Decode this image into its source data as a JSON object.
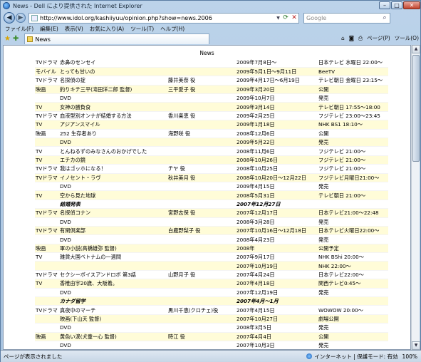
{
  "window": {
    "title": "News - Dell により提供された Internet Explorer"
  },
  "address": {
    "url": "http://www.idol.org/kashiiyuu/opinion.php?show=news.2006",
    "search_placeholder": "Google"
  },
  "menu": [
    "ファイル(F)",
    "編集(E)",
    "表示(V)",
    "お気に入り(A)",
    "ツール(T)",
    "ヘルプ(H)"
  ],
  "tab": {
    "label": "News"
  },
  "commands": {
    "page": "ページ(P)",
    "tools": "ツール(O)"
  },
  "page": {
    "heading": "News",
    "rows": [
      {
        "cat": "TVドラマ",
        "title": "赤鼻のセンセイ",
        "role": "",
        "date": "2009年7月8日～",
        "info": "日本テレビ 水曜日 22:00～",
        "alt": false,
        "section": false
      },
      {
        "cat": "モバイル",
        "title": "とっても甘いの",
        "role": "",
        "date": "2009年5月1日～9月11日",
        "info": "BeeTV",
        "alt": true,
        "section": false
      },
      {
        "cat": "TVドラマ",
        "title": "名探偵の掟",
        "role": "藤井美奈 役",
        "date": "2009年4月17日～6月19日",
        "info": "テレビ朝日 金曜日 23:15～",
        "alt": false,
        "section": false
      },
      {
        "cat": "映画",
        "title": "釣りキチ三平(滝田洋二郎 監督)",
        "role": "三平愛子 役",
        "date": "2009年3月20日",
        "info": "公開",
        "alt": true,
        "section": false
      },
      {
        "cat": "",
        "title": "DVD",
        "role": "",
        "date": "2009年10月7日",
        "info": "発売",
        "alt": false,
        "section": false
      },
      {
        "cat": "TV",
        "title": "女神の勝負食",
        "role": "",
        "date": "2009年3月14日",
        "info": "テレビ朝日 17:55～18:00",
        "alt": true,
        "section": false
      },
      {
        "cat": "TVドラマ",
        "title": "血液型別オンナが結婚する方法",
        "role": "香川楽恵 役",
        "date": "2009年2月25日",
        "info": "フジテレビ 23:00～23:45",
        "alt": false,
        "section": false
      },
      {
        "cat": "TV",
        "title": "アジアンスマイル",
        "role": "",
        "date": "2009年1月18日",
        "info": "NHK BS1 18:10～",
        "alt": true,
        "section": false
      },
      {
        "cat": "映画",
        "title": "252 生存者あり",
        "role": "海野咲 役",
        "date": "2008年12月6日",
        "info": "公開",
        "alt": false,
        "section": false
      },
      {
        "cat": "",
        "title": "DVD",
        "role": "",
        "date": "2009年5月22日",
        "info": "発売",
        "alt": true,
        "section": false
      },
      {
        "cat": "TV",
        "title": "とんねるずのみなさんのおかげでした",
        "role": "",
        "date": "2008年11月6日",
        "info": "フジテレビ 21:00～",
        "alt": false,
        "section": false
      },
      {
        "cat": "TV",
        "title": "エチカの鏡",
        "role": "",
        "date": "2008年10月26日",
        "info": "フジテレビ 21:00～",
        "alt": true,
        "section": false
      },
      {
        "cat": "TVドラマ",
        "title": "我はゴッホになる！",
        "role": "チヤ 役",
        "date": "2008年10月25日",
        "info": "フジテレビ 21:00～",
        "alt": false,
        "section": false
      },
      {
        "cat": "TVドラマ",
        "title": "イノセント・ラヴ",
        "role": "秋井美月 役",
        "date": "2008年10月20日～12月22日",
        "info": "フジテレビ月曜日21:00～",
        "alt": true,
        "section": false
      },
      {
        "cat": "",
        "title": "DVD",
        "role": "",
        "date": "2009年4月15日",
        "info": "発売",
        "alt": false,
        "section": false
      },
      {
        "cat": "TV",
        "title": "空から見た地球",
        "role": "",
        "date": "2008年5月31日",
        "info": "テレビ朝日 21:00～",
        "alt": true,
        "section": false
      },
      {
        "cat": "",
        "title": "結婚発表",
        "role": "",
        "date": "2007年12月27日",
        "info": "",
        "alt": false,
        "section": true
      },
      {
        "cat": "TVドラマ",
        "title": "名探偵コナン",
        "role": "宮野志保 役",
        "date": "2007年12月17日",
        "info": "日本テレビ21:00～22:48",
        "alt": true,
        "section": false
      },
      {
        "cat": "",
        "title": "DVD",
        "role": "",
        "date": "2008年3月28日",
        "info": "発売",
        "alt": false,
        "section": false
      },
      {
        "cat": "TVドラマ",
        "title": "有閑倶楽部",
        "role": "白鹿野梨子 役",
        "date": "2007年10月16日～12月18日",
        "info": "日本テレビ火曜日22:00～",
        "alt": true,
        "section": false
      },
      {
        "cat": "",
        "title": "DVD",
        "role": "",
        "date": "2008年4月23日",
        "info": "発売",
        "alt": false,
        "section": false
      },
      {
        "cat": "映画",
        "title": "軍の小説(高橋雄弥 監督)",
        "role": "",
        "date": "2008年",
        "info": "公開予定",
        "alt": true,
        "section": false
      },
      {
        "cat": "TV",
        "title": "雑貨大国ベトナムの一週間",
        "role": "",
        "date": "2007年9月17日",
        "info": "NHK BShi 20:00～",
        "alt": false,
        "section": false
      },
      {
        "cat": "",
        "title": "",
        "role": "",
        "date": "2007年10月19日",
        "info": "NHK 22:00～",
        "alt": true,
        "section": false
      },
      {
        "cat": "TVドラマ",
        "title": "セクシーボイスアンドロボ 第3話",
        "role": "山野月子 役",
        "date": "2007年4月24日",
        "info": "日本テレビ22:00～",
        "alt": false,
        "section": false
      },
      {
        "cat": "TV",
        "title": "香椎由宇20歳、大阪着。",
        "role": "",
        "date": "2007年4月18日",
        "info": "関西テレビ0:45～",
        "alt": true,
        "section": false
      },
      {
        "cat": "",
        "title": "DVD",
        "role": "",
        "date": "2007年12月19日",
        "info": "発売",
        "alt": false,
        "section": false
      },
      {
        "cat": "",
        "title": "カナダ留学",
        "role": "",
        "date": "2007年4月～1月",
        "info": "",
        "alt": true,
        "section": true
      },
      {
        "cat": "TVドラマ",
        "title": "真夜中のマーチ",
        "role": "黒川千恵(クロチェ)役",
        "date": "2007年4月15日",
        "info": "WOWOW 20:00～",
        "alt": false,
        "section": false
      },
      {
        "cat": "",
        "title": "映画(下山天 監督)",
        "role": "",
        "date": "2007年10月27日",
        "info": "劇場公開",
        "alt": true,
        "section": false
      },
      {
        "cat": "",
        "title": "DVD",
        "role": "",
        "date": "2008年3月5日",
        "info": "発売",
        "alt": false,
        "section": false
      },
      {
        "cat": "映画",
        "title": "黄色い涙(犬童一心 監督)",
        "role": "時江 役",
        "date": "2007年4月4日",
        "info": "公開",
        "alt": true,
        "section": false
      },
      {
        "cat": "",
        "title": "DVD",
        "role": "",
        "date": "2007年10月3日",
        "info": "発売",
        "alt": false,
        "section": false
      },
      {
        "cat": "TV",
        "title": "伝説の白きライオンを求めて",
        "role": "",
        "date": "2007年3月3日",
        "info": "フジテレビ14:35～",
        "alt": true,
        "section": false
      }
    ]
  },
  "status": {
    "left": "ページが表示されました",
    "zone": "インターネット | 保護モード: 有効",
    "zoom": "100%"
  }
}
